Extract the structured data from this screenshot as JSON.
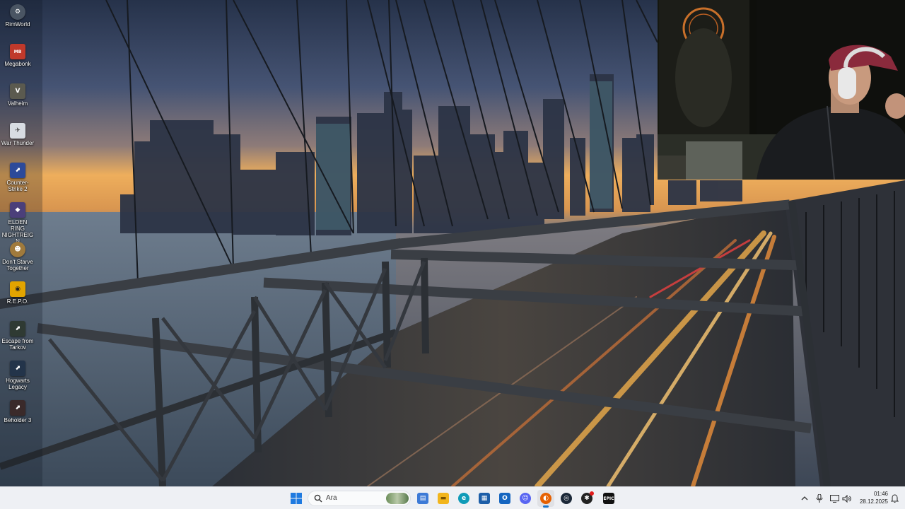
{
  "desktop": {
    "icons": [
      {
        "label": "RimWorld",
        "icon": "rimworld-icon",
        "color": "#4a5563"
      },
      {
        "label": "Megabonk",
        "icon": "megabonk-icon",
        "color": "#c0392b"
      },
      {
        "label": "Valheim",
        "icon": "valheim-icon",
        "color": "#5b5a4f"
      },
      {
        "label": "War Thunder",
        "icon": "war-thunder-icon",
        "color": "#d8dce2"
      },
      {
        "label": "Counter-Strike 2",
        "icon": "counter-strike-2-icon",
        "color": "#2c4a9a"
      },
      {
        "label": "ELDEN RING NIGHTREIGN",
        "icon": "elden-ring-nightreign-icon",
        "color": "#4b3f7a"
      },
      {
        "label": "Don't Starve Together",
        "icon": "dont-starve-together-icon",
        "color": "#a07a3c"
      },
      {
        "label": "R.E.P.O.",
        "icon": "repo-icon",
        "color": "#e2a400"
      },
      {
        "label": "Escape from Tarkov",
        "icon": "escape-from-tarkov-icon",
        "color": "#2f3a33"
      },
      {
        "label": "Hogwarts Legacy",
        "icon": "hogwarts-legacy-icon",
        "color": "#23344a"
      },
      {
        "label": "Beholder 3",
        "icon": "beholder-3-icon",
        "color": "#3a2a2a"
      }
    ]
  },
  "taskbar": {
    "search_placeholder": "Ara",
    "apps": [
      {
        "name": "start",
        "icon": "windows-start-icon",
        "color": "#1f7ae0"
      },
      {
        "name": "news-widget",
        "icon": "news-icon",
        "color": "#3d7ad6"
      },
      {
        "name": "file-explorer",
        "icon": "folder-icon",
        "color": "#f2b51c"
      },
      {
        "name": "edge",
        "icon": "edge-icon",
        "color": "#0f9bb8"
      },
      {
        "name": "microsoft-store",
        "icon": "store-icon",
        "color": "#1c5ea8"
      },
      {
        "name": "outlook",
        "icon": "outlook-icon",
        "color": "#1565c0"
      },
      {
        "name": "discord",
        "icon": "discord-icon",
        "color": "#5865f2"
      },
      {
        "name": "firefox",
        "icon": "firefox-icon",
        "color": "#e66000"
      },
      {
        "name": "steam",
        "icon": "steam-icon",
        "color": "#1b2838"
      },
      {
        "name": "steelseries-gg",
        "icon": "steelseries-icon",
        "color": "#222222"
      },
      {
        "name": "epic-games",
        "icon": "epic-games-icon",
        "color": "#111111"
      }
    ],
    "clock": {
      "time": "01:46",
      "date": "28.12.2025"
    }
  }
}
